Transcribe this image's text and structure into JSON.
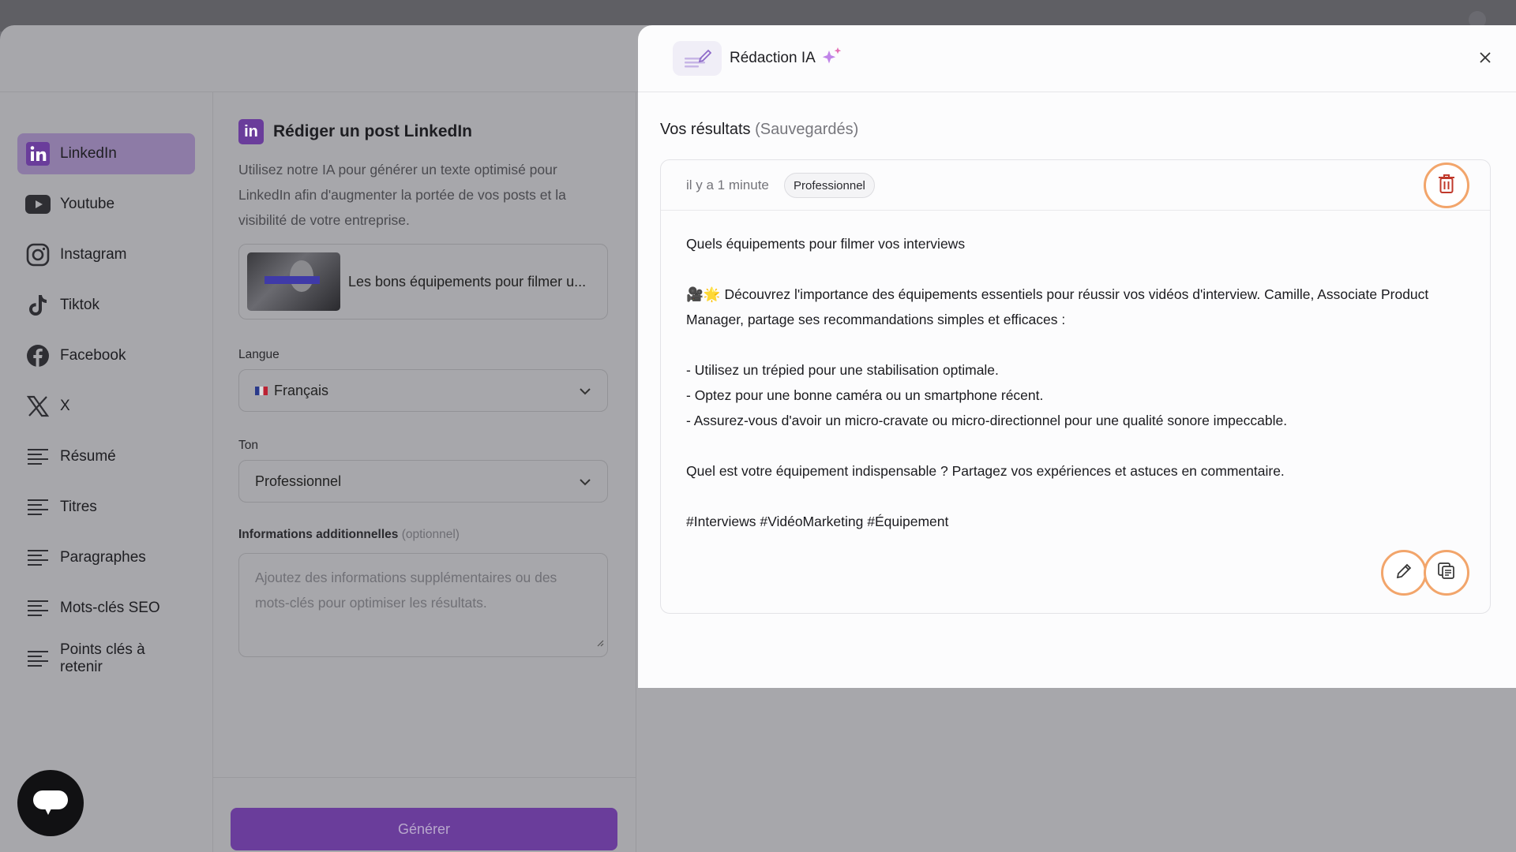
{
  "sidebar": {
    "items": [
      {
        "label": "LinkedIn",
        "icon": "linkedin-icon",
        "active": true
      },
      {
        "label": "Youtube",
        "icon": "youtube-icon"
      },
      {
        "label": "Instagram",
        "icon": "instagram-icon"
      },
      {
        "label": "Tiktok",
        "icon": "tiktok-icon"
      },
      {
        "label": "Facebook",
        "icon": "facebook-icon"
      },
      {
        "label": "X",
        "icon": "x-icon"
      },
      {
        "label": "Résumé",
        "icon": "lines-icon"
      },
      {
        "label": "Titres",
        "icon": "lines-icon"
      },
      {
        "label": "Paragraphes",
        "icon": "lines-icon"
      },
      {
        "label": "Mots-clés SEO",
        "icon": "lines-icon"
      },
      {
        "label": "Points clés à retenir",
        "icon": "lines-icon"
      }
    ]
  },
  "form": {
    "badge": "in",
    "title": "Rédiger un post LinkedIn",
    "description": "Utilisez notre IA pour générer un texte optimisé pour LinkedIn afin d'augmenter la portée de vos posts et la visibilité de votre entreprise.",
    "video_title": "Les bons équipements pour filmer u...",
    "language_label": "Langue",
    "language_value": "Français",
    "tone_label": "Ton",
    "tone_value": "Professionnel",
    "additional_label": "Informations additionnelles",
    "additional_optional": "(optionnel)",
    "additional_placeholder": "Ajoutez des informations supplémentaires ou des mots-clés pour optimiser les résultats.",
    "generate_label": "Générer"
  },
  "panel": {
    "title": "Rédaction IA",
    "results_title": "Vos résultats",
    "results_saved": "(Sauvegardés)",
    "result": {
      "time": "il y a 1 minute",
      "tone_tag": "Professionnel",
      "lines": [
        "Quels équipements pour filmer vos interviews",
        "",
        "🎥🌟 Découvrez l'importance des équipements essentiels pour réussir vos vidéos d'interview. Camille, Associate Product Manager, partage ses recommandations simples et efficaces :",
        "",
        "- Utilisez un trépied pour une stabilisation optimale.",
        "- Optez pour une bonne caméra ou un smartphone récent.",
        "- Assurez-vous d'avoir un micro-cravate ou micro-directionnel pour une qualité sonore impeccable.",
        "",
        "Quel est votre équipement indispensable ? Partagez vos expériences et astuces en commentaire.",
        "",
        "#Interviews #VidéoMarketing #Équipement"
      ]
    }
  },
  "colors": {
    "accent": "#6a3d9b",
    "highlight_ring": "#f2a56b",
    "delete": "#c0392b"
  }
}
